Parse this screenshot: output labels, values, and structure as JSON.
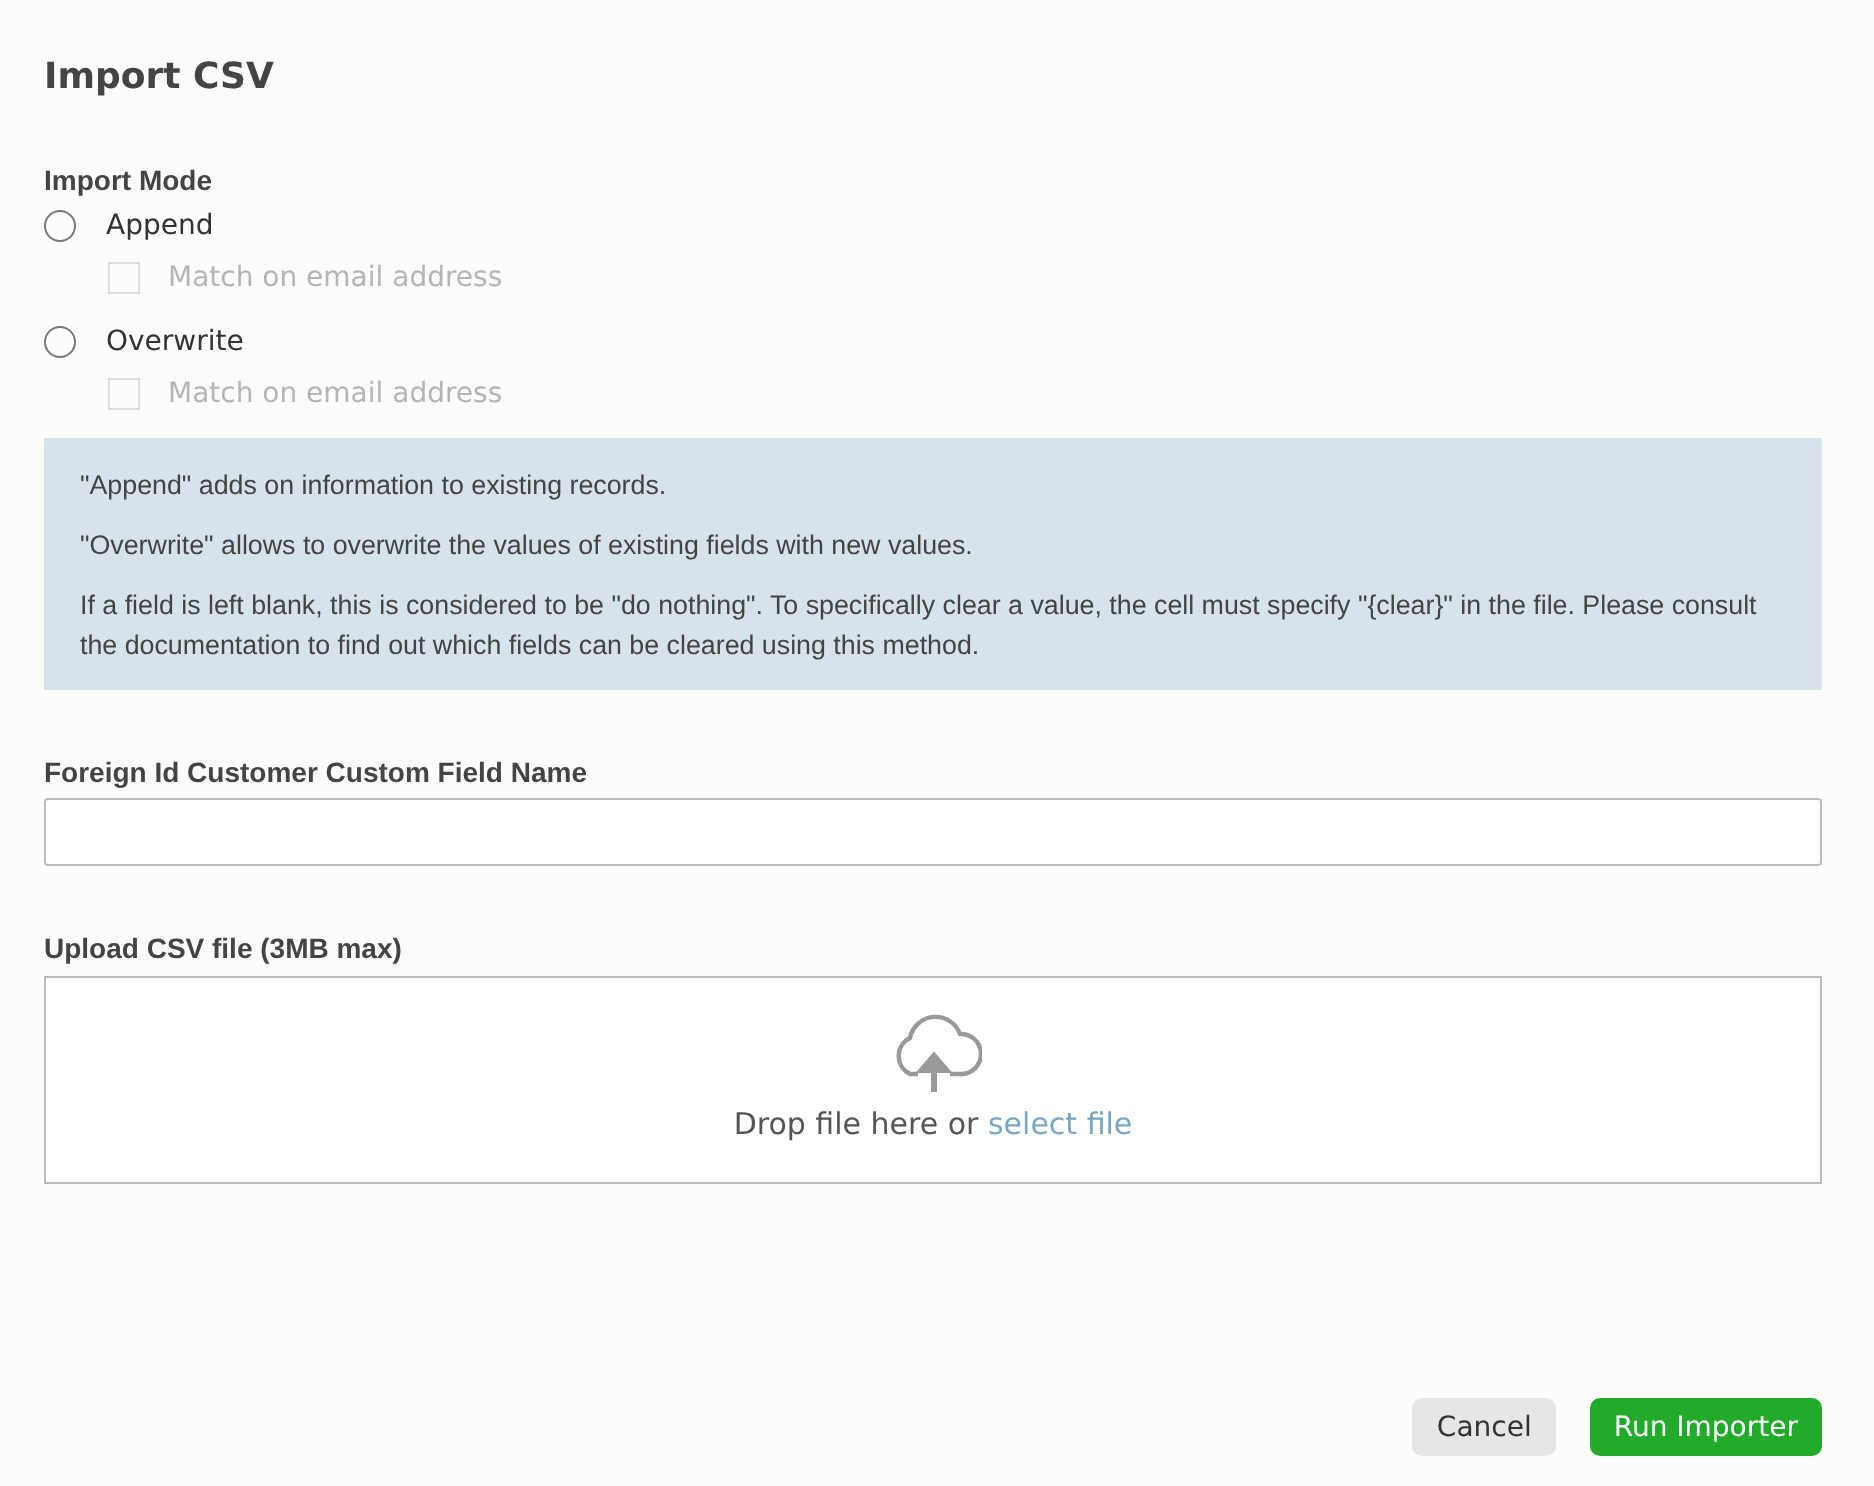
{
  "title": "Import CSV",
  "import_mode": {
    "label": "Import Mode",
    "options": [
      {
        "label": "Append",
        "selected": false,
        "checkbox": {
          "label": "Match on email address",
          "checked": false,
          "disabled": true
        }
      },
      {
        "label": "Overwrite",
        "selected": false,
        "checkbox": {
          "label": "Match on email address",
          "checked": false,
          "disabled": true
        }
      }
    ]
  },
  "info": [
    "\"Append\" adds on information to existing records.",
    "\"Overwrite\" allows to overwrite the values of existing fields with new values.",
    "If a field is left blank, this is considered to be \"do nothing\". To specifically clear a value, the cell must specify \"{clear}\" in the file. Please consult the documentation to find out which fields can be cleared using this method."
  ],
  "foreign_id_field": {
    "label": "Foreign Id Customer Custom Field Name"
  },
  "upload": {
    "label": "Upload CSV file (3MB max)",
    "prompt": "Drop file here or",
    "link": "select file"
  },
  "buttons": [
    {
      "label": "Cancel",
      "kind": "secondary"
    },
    {
      "label": "Run Importer",
      "kind": "primary"
    }
  ]
}
